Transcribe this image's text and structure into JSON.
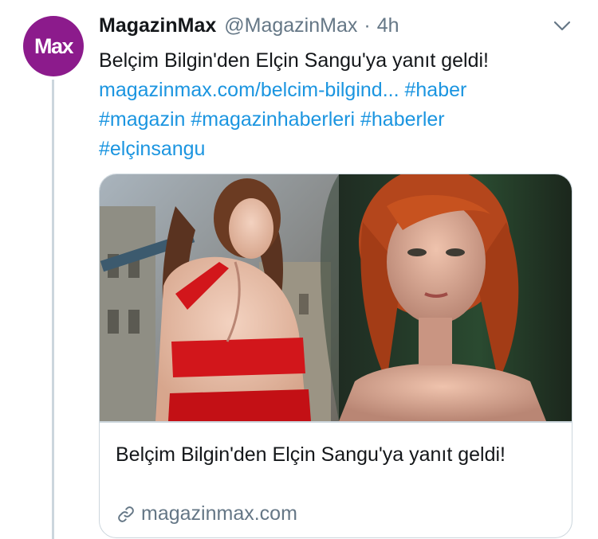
{
  "tweet": {
    "avatar_text": "Max",
    "author_name": "MagazinMax",
    "author_handle": "@MagazinMax",
    "separator": "·",
    "time": "4h",
    "text_line1": "Belçim Bilgin'den Elçin Sangu'ya yanıt geldi!",
    "link_url": "magazinmax.com/belcim-bilgind...",
    "hashtags": [
      "#haber",
      "#magazin",
      "#magazinhaberleri",
      "#haberler",
      "#elçinsangu"
    ]
  },
  "card": {
    "title": "Belçim Bilgin'den Elçin Sangu'ya yanıt geldi!",
    "domain": "magazinmax.com",
    "link_icon": "link-icon"
  },
  "colors": {
    "avatar_bg": "#8c1b8c",
    "link": "#1b95e0",
    "secondary_text": "#657786",
    "border": "#ccd6dd"
  }
}
